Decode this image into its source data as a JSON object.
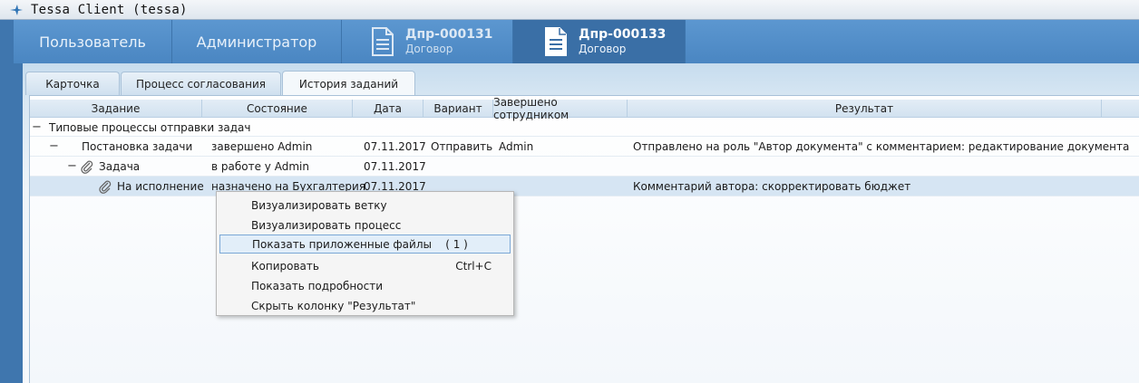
{
  "window": {
    "title": "Tessa Client (tessa)"
  },
  "nav": {
    "user_label": "Пользователь",
    "admin_label": "Администратор",
    "documents": [
      {
        "number": "Дпр-000131",
        "type": "Договор"
      },
      {
        "number": "Дпр-000133",
        "type": "Договор"
      }
    ]
  },
  "tabs": [
    {
      "label": "Карточка"
    },
    {
      "label": "Процесс согласования"
    },
    {
      "label": "История заданий"
    }
  ],
  "grid": {
    "columns": [
      "Задание",
      "Состояние",
      "Дата",
      "Вариант",
      "Завершено сотрудником",
      "Результат"
    ],
    "group": {
      "label": "Типовые процессы отправки задач"
    },
    "rows": [
      {
        "task": "Постановка задачи",
        "state": "завершено Admin",
        "date": "07.11.2017",
        "option": "Отправить",
        "completed_by": "Admin",
        "result": "Отправлено на роль \"Автор документа\" с комментарием: редактирование документа"
      },
      {
        "task": "Задача",
        "state": "в работе у Admin",
        "date": "07.11.2017",
        "option": "",
        "completed_by": "",
        "result": ""
      },
      {
        "task": "На исполнение",
        "state": "назначено на Бухгалтерия",
        "date": "07.11.2017",
        "option": "",
        "completed_by": "",
        "result": "Комментарий автора: скорректировать бюджет"
      }
    ]
  },
  "context_menu": {
    "items": [
      {
        "label": "Визуализировать ветку",
        "shortcut": ""
      },
      {
        "label": "Визуализировать процесс",
        "shortcut": ""
      },
      {
        "label": "Показать приложенные файлы    ( 1 )",
        "shortcut": ""
      },
      {
        "label": "Копировать",
        "shortcut": "Ctrl+C"
      },
      {
        "label": "Показать подробности",
        "shortcut": ""
      },
      {
        "label": "Скрыть колонку \"Результат\"",
        "shortcut": ""
      }
    ]
  }
}
